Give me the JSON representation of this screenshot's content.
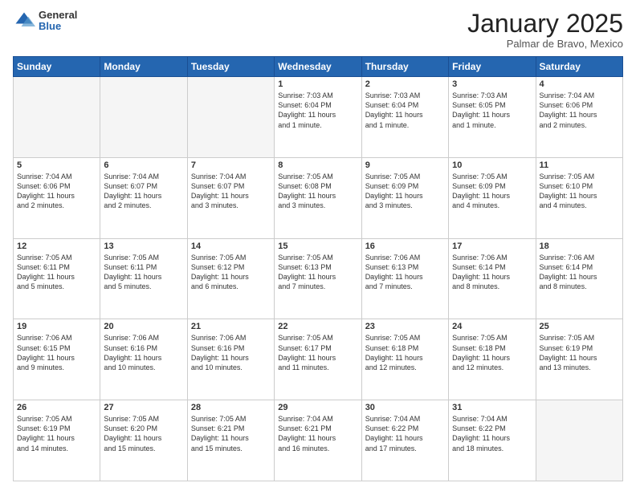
{
  "header": {
    "logo_general": "General",
    "logo_blue": "Blue",
    "title": "January 2025",
    "location": "Palmar de Bravo, Mexico"
  },
  "weekdays": [
    "Sunday",
    "Monday",
    "Tuesday",
    "Wednesday",
    "Thursday",
    "Friday",
    "Saturday"
  ],
  "weeks": [
    [
      {
        "day": "",
        "text": ""
      },
      {
        "day": "",
        "text": ""
      },
      {
        "day": "",
        "text": ""
      },
      {
        "day": "1",
        "text": "Sunrise: 7:03 AM\nSunset: 6:04 PM\nDaylight: 11 hours\nand 1 minute."
      },
      {
        "day": "2",
        "text": "Sunrise: 7:03 AM\nSunset: 6:04 PM\nDaylight: 11 hours\nand 1 minute."
      },
      {
        "day": "3",
        "text": "Sunrise: 7:03 AM\nSunset: 6:05 PM\nDaylight: 11 hours\nand 1 minute."
      },
      {
        "day": "4",
        "text": "Sunrise: 7:04 AM\nSunset: 6:06 PM\nDaylight: 11 hours\nand 2 minutes."
      }
    ],
    [
      {
        "day": "5",
        "text": "Sunrise: 7:04 AM\nSunset: 6:06 PM\nDaylight: 11 hours\nand 2 minutes."
      },
      {
        "day": "6",
        "text": "Sunrise: 7:04 AM\nSunset: 6:07 PM\nDaylight: 11 hours\nand 2 minutes."
      },
      {
        "day": "7",
        "text": "Sunrise: 7:04 AM\nSunset: 6:07 PM\nDaylight: 11 hours\nand 3 minutes."
      },
      {
        "day": "8",
        "text": "Sunrise: 7:05 AM\nSunset: 6:08 PM\nDaylight: 11 hours\nand 3 minutes."
      },
      {
        "day": "9",
        "text": "Sunrise: 7:05 AM\nSunset: 6:09 PM\nDaylight: 11 hours\nand 3 minutes."
      },
      {
        "day": "10",
        "text": "Sunrise: 7:05 AM\nSunset: 6:09 PM\nDaylight: 11 hours\nand 4 minutes."
      },
      {
        "day": "11",
        "text": "Sunrise: 7:05 AM\nSunset: 6:10 PM\nDaylight: 11 hours\nand 4 minutes."
      }
    ],
    [
      {
        "day": "12",
        "text": "Sunrise: 7:05 AM\nSunset: 6:11 PM\nDaylight: 11 hours\nand 5 minutes."
      },
      {
        "day": "13",
        "text": "Sunrise: 7:05 AM\nSunset: 6:11 PM\nDaylight: 11 hours\nand 5 minutes."
      },
      {
        "day": "14",
        "text": "Sunrise: 7:05 AM\nSunset: 6:12 PM\nDaylight: 11 hours\nand 6 minutes."
      },
      {
        "day": "15",
        "text": "Sunrise: 7:05 AM\nSunset: 6:13 PM\nDaylight: 11 hours\nand 7 minutes."
      },
      {
        "day": "16",
        "text": "Sunrise: 7:06 AM\nSunset: 6:13 PM\nDaylight: 11 hours\nand 7 minutes."
      },
      {
        "day": "17",
        "text": "Sunrise: 7:06 AM\nSunset: 6:14 PM\nDaylight: 11 hours\nand 8 minutes."
      },
      {
        "day": "18",
        "text": "Sunrise: 7:06 AM\nSunset: 6:14 PM\nDaylight: 11 hours\nand 8 minutes."
      }
    ],
    [
      {
        "day": "19",
        "text": "Sunrise: 7:06 AM\nSunset: 6:15 PM\nDaylight: 11 hours\nand 9 minutes."
      },
      {
        "day": "20",
        "text": "Sunrise: 7:06 AM\nSunset: 6:16 PM\nDaylight: 11 hours\nand 10 minutes."
      },
      {
        "day": "21",
        "text": "Sunrise: 7:06 AM\nSunset: 6:16 PM\nDaylight: 11 hours\nand 10 minutes."
      },
      {
        "day": "22",
        "text": "Sunrise: 7:05 AM\nSunset: 6:17 PM\nDaylight: 11 hours\nand 11 minutes."
      },
      {
        "day": "23",
        "text": "Sunrise: 7:05 AM\nSunset: 6:18 PM\nDaylight: 11 hours\nand 12 minutes."
      },
      {
        "day": "24",
        "text": "Sunrise: 7:05 AM\nSunset: 6:18 PM\nDaylight: 11 hours\nand 12 minutes."
      },
      {
        "day": "25",
        "text": "Sunrise: 7:05 AM\nSunset: 6:19 PM\nDaylight: 11 hours\nand 13 minutes."
      }
    ],
    [
      {
        "day": "26",
        "text": "Sunrise: 7:05 AM\nSunset: 6:19 PM\nDaylight: 11 hours\nand 14 minutes."
      },
      {
        "day": "27",
        "text": "Sunrise: 7:05 AM\nSunset: 6:20 PM\nDaylight: 11 hours\nand 15 minutes."
      },
      {
        "day": "28",
        "text": "Sunrise: 7:05 AM\nSunset: 6:21 PM\nDaylight: 11 hours\nand 15 minutes."
      },
      {
        "day": "29",
        "text": "Sunrise: 7:04 AM\nSunset: 6:21 PM\nDaylight: 11 hours\nand 16 minutes."
      },
      {
        "day": "30",
        "text": "Sunrise: 7:04 AM\nSunset: 6:22 PM\nDaylight: 11 hours\nand 17 minutes."
      },
      {
        "day": "31",
        "text": "Sunrise: 7:04 AM\nSunset: 6:22 PM\nDaylight: 11 hours\nand 18 minutes."
      },
      {
        "day": "",
        "text": ""
      }
    ]
  ]
}
